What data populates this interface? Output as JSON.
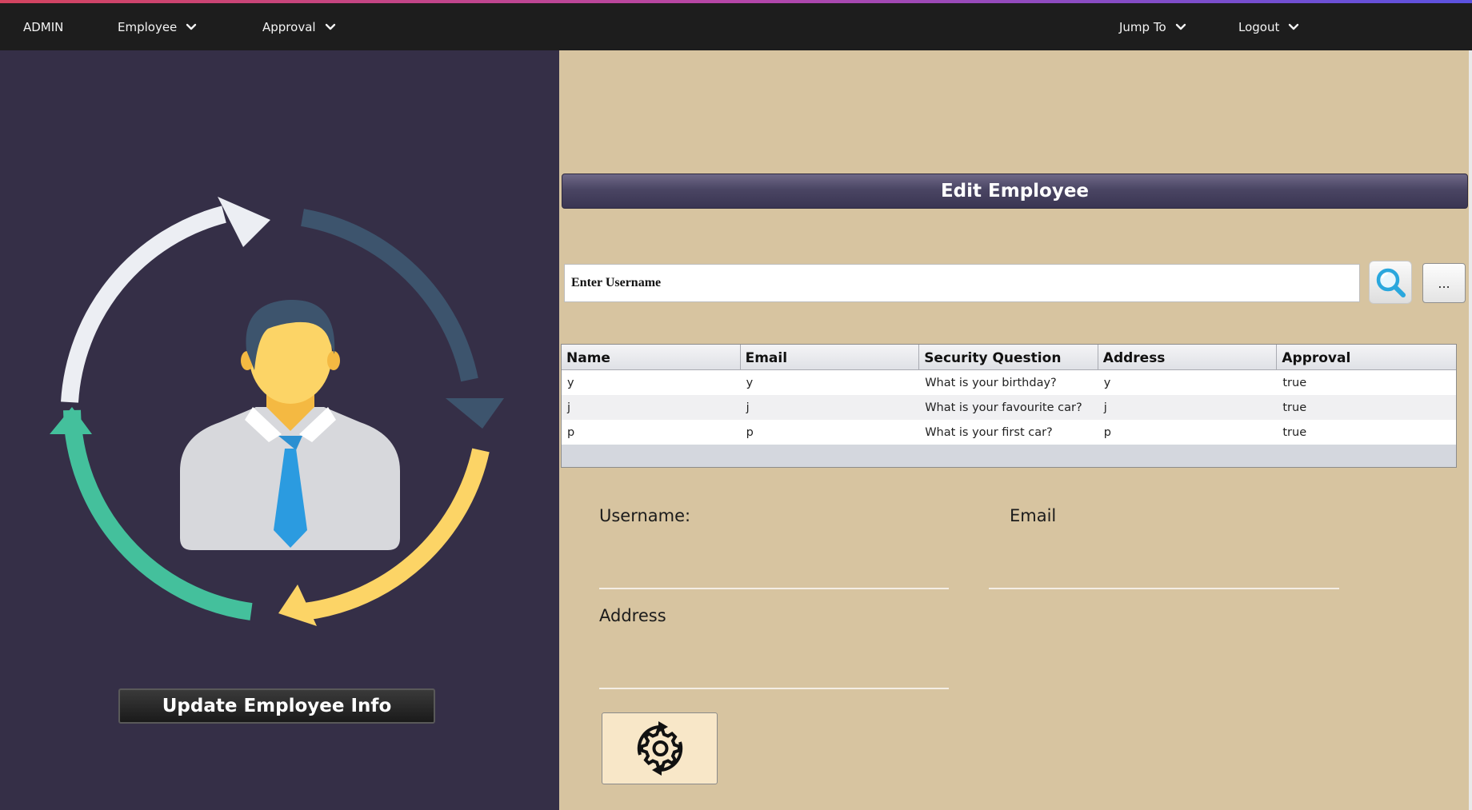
{
  "nav": {
    "admin": "ADMIN",
    "employee": "Employee",
    "approval": "Approval",
    "jump_to": "Jump To",
    "logout": "Logout"
  },
  "left": {
    "update_button": "Update Employee Info"
  },
  "main": {
    "header": "Edit Employee",
    "search_placeholder": "Enter Username",
    "more_button": "...",
    "table": {
      "columns": [
        "Name",
        "Email",
        "Security Question",
        "Address",
        "Approval"
      ],
      "rows": [
        [
          "y",
          "y",
          "What is your birthday?",
          "y",
          "true"
        ],
        [
          "j",
          "j",
          "What is your favourite car?",
          "j",
          "true"
        ],
        [
          "p",
          "p",
          "What is your first car?",
          "p",
          "true"
        ]
      ]
    },
    "form": {
      "username_label": "Username:",
      "email_label": "Email",
      "address_label": "Address"
    }
  },
  "colors": {
    "topbar": "#1d1d1d",
    "left_panel": "#352f47",
    "right_panel": "#d7c4a0",
    "arrow_white": "#eceef3",
    "arrow_navy": "#3d546d",
    "arrow_yellow": "#fcd466",
    "arrow_teal": "#44c09c",
    "search_icon": "#2aa7dd"
  },
  "icons": [
    "chevron-down-icon",
    "magnifier-icon",
    "gear-refresh-icon",
    "employee-avatar-icon"
  ]
}
